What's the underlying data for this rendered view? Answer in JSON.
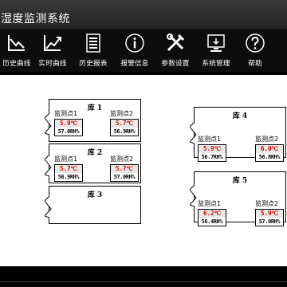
{
  "title": "湿度监测系统",
  "toolbar": [
    {
      "label": "历史曲线",
      "icon": "history-curve-icon"
    },
    {
      "label": "实时曲线",
      "icon": "realtime-curve-icon"
    },
    {
      "label": "历史报表",
      "icon": "history-report-icon"
    },
    {
      "label": "报警信息",
      "icon": "info-icon"
    },
    {
      "label": "参数设置",
      "icon": "tools-icon"
    },
    {
      "label": "系统管理",
      "icon": "system-icon"
    },
    {
      "label": "帮助",
      "icon": "help-icon"
    }
  ],
  "rooms": [
    {
      "name": "库 1",
      "points": [
        {
          "name": "监测点1",
          "temp": "5.9℃",
          "hum": "57.0RH%"
        },
        {
          "name": "监测点2",
          "temp": "5.7℃",
          "hum": "56.9RH%"
        }
      ]
    },
    {
      "name": "库 2",
      "points": [
        {
          "name": "监测点1",
          "temp": "5.7℃",
          "hum": "56.9RH%"
        },
        {
          "name": "监测点2",
          "temp": "5.7℃",
          "hum": "57.0RH%"
        }
      ]
    },
    {
      "name": "库 3",
      "points": []
    },
    {
      "name": "库 4",
      "points": [
        {
          "name": "监测点1",
          "temp": "5.9℃",
          "hum": "56.7RH%"
        },
        {
          "name": "监测点2",
          "temp": "6.0℃",
          "hum": "56.8RH%"
        }
      ]
    },
    {
      "name": "库 5",
      "points": [
        {
          "name": "监测点1",
          "temp": "6.2℃",
          "hum": "56.4RH%"
        },
        {
          "name": "监测点2",
          "temp": "5.9℃",
          "hum": "57.0RH%"
        }
      ]
    }
  ],
  "colors": {
    "temperature": "#e00000",
    "background": "#000000",
    "panel": "#ffffff"
  }
}
